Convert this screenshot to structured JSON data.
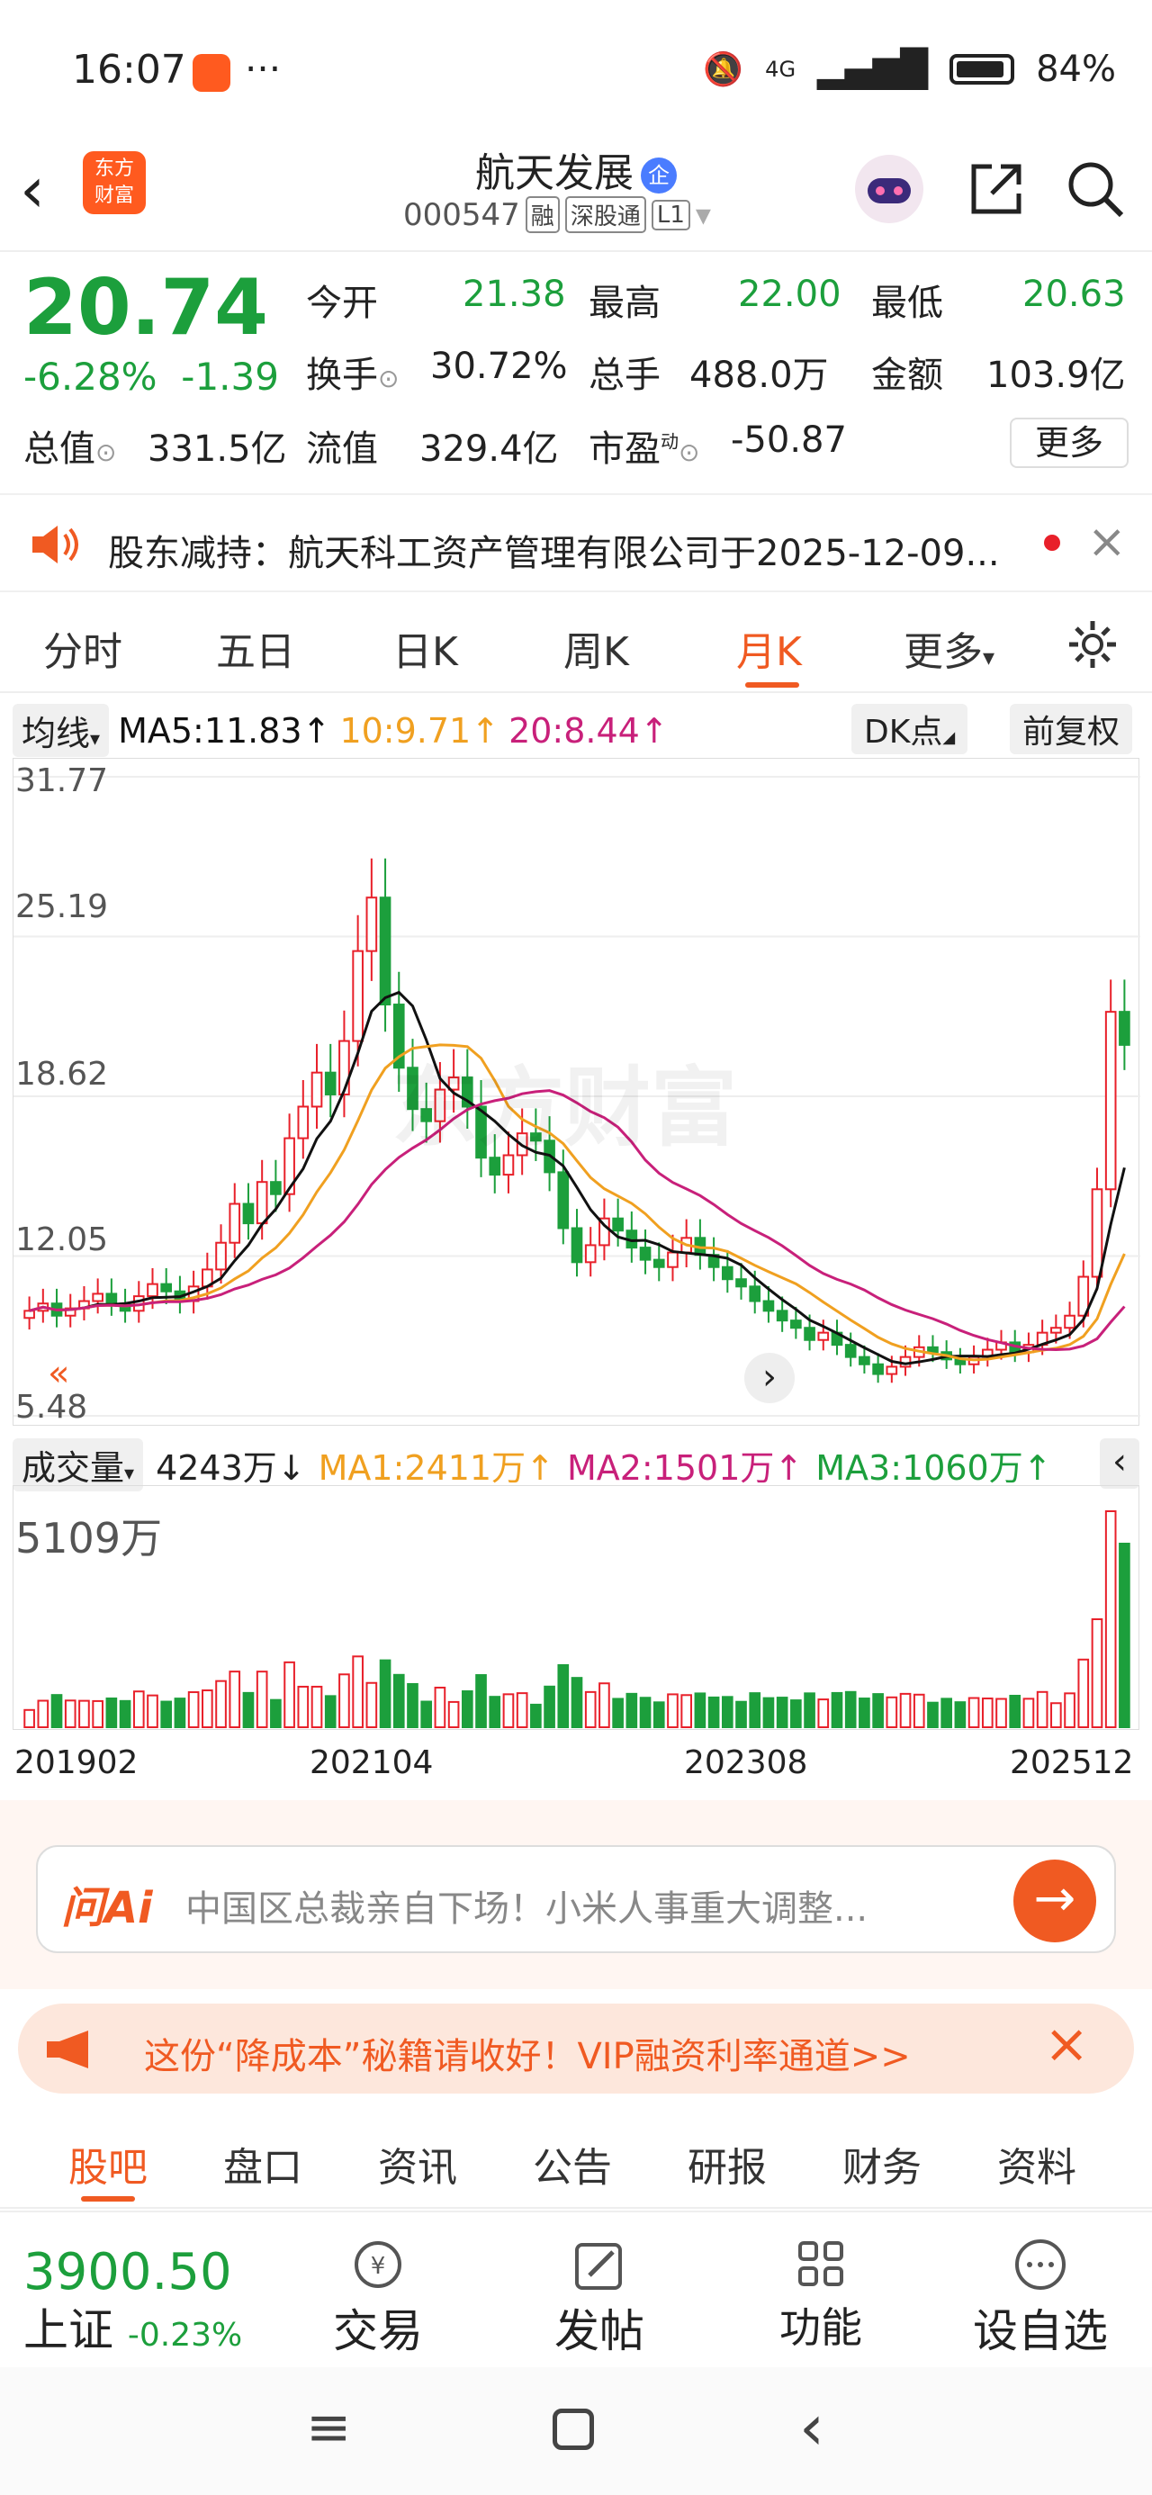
{
  "status": {
    "time": "16:07",
    "battery": "84%",
    "network": "4G"
  },
  "header": {
    "logo_text": "东方\n财富",
    "title": "航天发展",
    "title_badge": "企",
    "code": "000547",
    "tags": [
      "融",
      "深股通",
      "L1"
    ]
  },
  "quote": {
    "price": "20.74",
    "change_pct": "-6.28%",
    "change": "-1.39",
    "open_label": "今开",
    "open": "21.38",
    "high_label": "最高",
    "high": "22.00",
    "low_label": "最低",
    "low": "20.63",
    "turnover_label": "换手",
    "turnover": "30.72%",
    "volume_label": "总手",
    "volume": "488.0万",
    "amount_label": "金额",
    "amount": "103.9亿",
    "mktcap_label": "总值",
    "mktcap": "331.5亿",
    "float_label": "流值",
    "float": "329.4亿",
    "pe_label": "市盈",
    "pe_sup": "动",
    "pe": "-50.87",
    "more": "更多"
  },
  "notice": {
    "text": "股东减持：航天科工资产管理有限公司于2025-12-09..."
  },
  "tabs": [
    "分时",
    "五日",
    "日K",
    "周K",
    "月K",
    "更多"
  ],
  "ma": {
    "label": "均线",
    "ma5": "MA5:11.83",
    "ma10": "10:9.71",
    "ma20": "20:8.44",
    "dk": "DK点",
    "adjust": "前复权"
  },
  "chart_data": {
    "type": "candlestick",
    "y_ticks": [
      "31.77",
      "25.19",
      "18.62",
      "12.05",
      "5.48"
    ],
    "ylim": [
      5.48,
      31.77
    ],
    "x_ticks": [
      "201902",
      "202104",
      "202308",
      "202512"
    ],
    "series": [
      {
        "name": "MA5",
        "color": "#111111"
      },
      {
        "name": "10",
        "color": "#f0a020"
      },
      {
        "name": "20",
        "color": "#c8207a"
      }
    ],
    "close": [
      9.8,
      10.1,
      9.6,
      9.9,
      10.2,
      10.5,
      10.1,
      9.8,
      10.4,
      10.9,
      10.6,
      10.2,
      10.8,
      11.5,
      12.6,
      14.2,
      13.4,
      15.1,
      14.6,
      16.9,
      18.2,
      19.6,
      18.7,
      20.9,
      24.6,
      26.8,
      22.4,
      19.8,
      18.1,
      17.6,
      18.9,
      19.4,
      18.2,
      16.1,
      15.4,
      16.2,
      17.1,
      16.8,
      15.5,
      13.2,
      11.8,
      12.5,
      13.6,
      13.1,
      12.4,
      11.9,
      11.6,
      12.2,
      12.8,
      12.1,
      11.6,
      11.1,
      10.8,
      10.2,
      9.8,
      9.4,
      9.1,
      8.6,
      8.9,
      8.4,
      7.9,
      7.6,
      7.2,
      7.5,
      7.9,
      8.3,
      8.1,
      7.8,
      7.6,
      7.9,
      8.2,
      8.5,
      8.1,
      8.4,
      8.9,
      9.1,
      9.6,
      11.2,
      14.8,
      22.1,
      20.74
    ],
    "volume_label": "成交量",
    "volume_value": "4243万",
    "vol_ma1": "MA1:2411万",
    "vol_ma2": "MA2:1501万",
    "vol_ma3": "MA3:1060万",
    "vol_max_label": "5109万"
  },
  "ai": {
    "label": "问Ai",
    "text": "中国区总裁亲自下场！小米人事重大调整..."
  },
  "promo": {
    "text": "这份“降成本”秘籍请收好！VIP融资利率通道>>"
  },
  "bottom_tabs": [
    "股吧",
    "盘口",
    "资讯",
    "公告",
    "研报",
    "财务",
    "资料"
  ],
  "index": {
    "value": "3900.50",
    "name": "上证",
    "change": "-0.23%"
  },
  "bottom_nav": [
    "交易",
    "发帖",
    "功能",
    "设自选"
  ]
}
